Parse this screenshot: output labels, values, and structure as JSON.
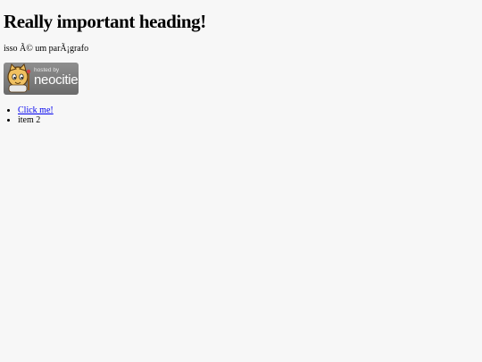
{
  "heading": "Really important heading!",
  "paragraph": "isso Ã© um parÃ¡grafo",
  "badge": {
    "small_text": "hosted by",
    "brand_text": "neocities"
  },
  "list": {
    "items": [
      {
        "label": "Click me!",
        "is_link": true
      },
      {
        "label": "item 2",
        "is_link": false
      }
    ]
  }
}
